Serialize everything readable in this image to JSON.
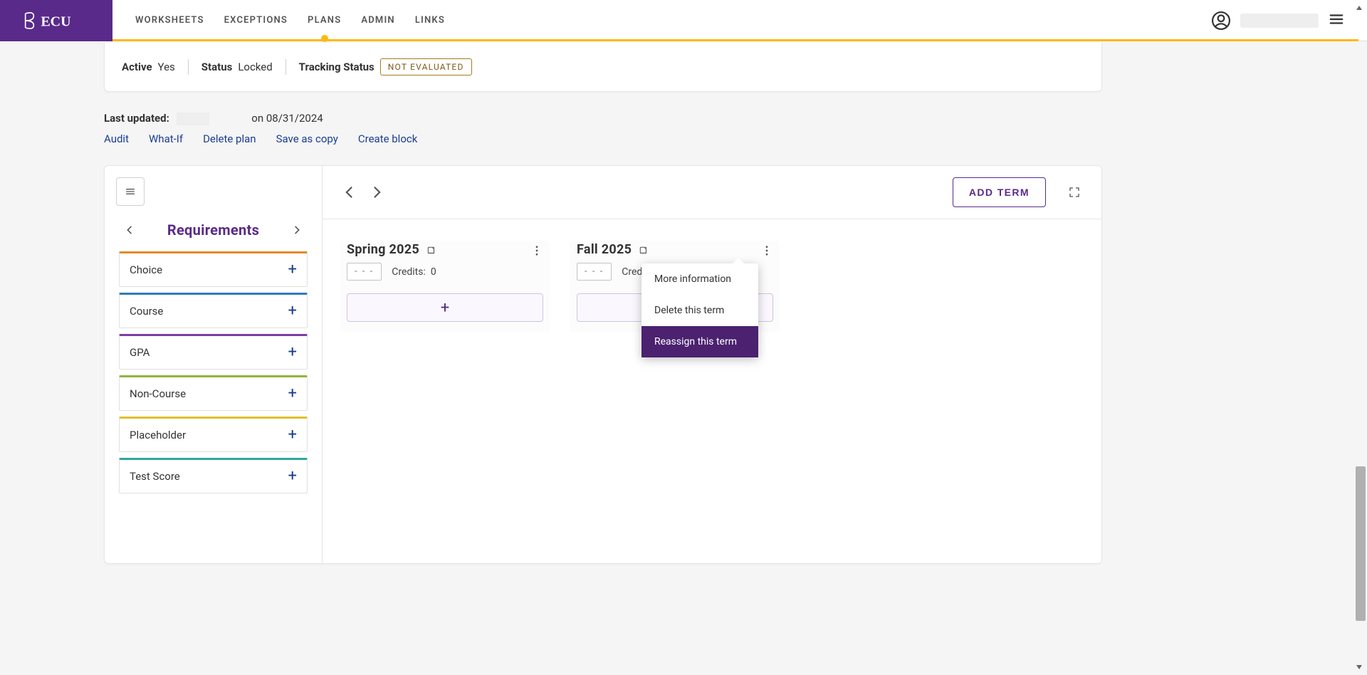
{
  "brand": "ECU",
  "nav": {
    "tabs": [
      {
        "label": "WORKSHEETS"
      },
      {
        "label": "EXCEPTIONS"
      },
      {
        "label": "PLANS"
      },
      {
        "label": "ADMIN"
      },
      {
        "label": "LINKS"
      }
    ],
    "active_index": 2
  },
  "status": {
    "active_label": "Active",
    "active_value": "Yes",
    "status_label": "Status",
    "status_value": "Locked",
    "tracking_label": "Tracking Status",
    "tracking_value": "NOT EVALUATED"
  },
  "meta": {
    "last_updated_label": "Last updated:",
    "on_text": "on",
    "date": "08/31/2024"
  },
  "links": {
    "audit": "Audit",
    "whatif": "What-If",
    "delete_plan": "Delete plan",
    "save_as_copy": "Save as copy",
    "create_block": "Create block"
  },
  "sidebar": {
    "title": "Requirements",
    "items": [
      {
        "label": "Choice",
        "color": "#e38b2a"
      },
      {
        "label": "Course",
        "color": "#2f7bbf"
      },
      {
        "label": "GPA",
        "color": "#7a3fa6"
      },
      {
        "label": "Non-Course",
        "color": "#8fb63d"
      },
      {
        "label": "Placeholder",
        "color": "#e3c02a"
      },
      {
        "label": "Test Score",
        "color": "#2fa79a"
      }
    ]
  },
  "planner": {
    "add_term_label": "ADD TERM",
    "terms": [
      {
        "title": "Spring 2025",
        "dash": "- - -",
        "credits_label": "Credits:",
        "credits_value": "0"
      },
      {
        "title": "Fall 2025",
        "dash": "- - -",
        "credits_label": "Credits:",
        "credits_value": ""
      }
    ]
  },
  "ctx_menu": {
    "more_info": "More information",
    "delete_term": "Delete this term",
    "reassign": "Reassign this term"
  }
}
